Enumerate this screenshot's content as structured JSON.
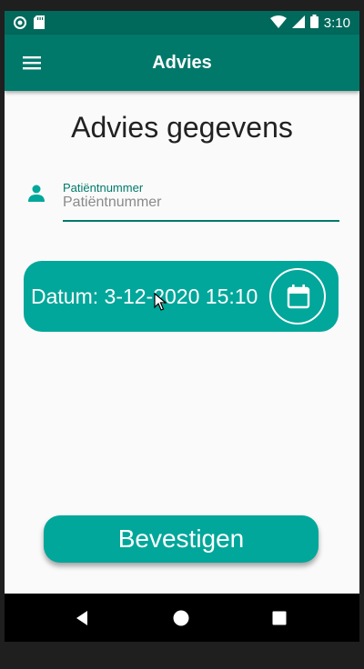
{
  "status_bar": {
    "time": "3:10",
    "icons": [
      "record-icon",
      "sd-card-icon",
      "wifi-icon",
      "signal-icon",
      "battery-icon"
    ]
  },
  "app_bar": {
    "title": "Advies",
    "menu_icon": "hamburger-menu-icon"
  },
  "form": {
    "heading": "Advies gegevens",
    "patient_field": {
      "label": "Patiëntnummer",
      "placeholder": "Patiëntnummer",
      "value": "",
      "icon": "person-icon"
    },
    "date": {
      "text": "Datum: 3-12-2020 15:10",
      "button_icon": "calendar-icon"
    },
    "confirm_label": "Bevestigen"
  },
  "nav_bar": {
    "icons": [
      "back-icon",
      "home-icon",
      "recents-icon"
    ]
  },
  "colors": {
    "status_bar": "#00695c",
    "app_bar": "#00796b",
    "accent": "#00a79a",
    "background": "#fafafa"
  }
}
